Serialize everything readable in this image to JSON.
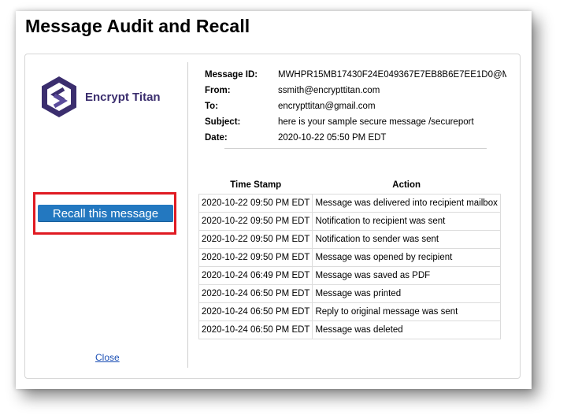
{
  "page": {
    "title": "Message Audit and Recall"
  },
  "logo": {
    "text": "Encrypt Titan"
  },
  "actions": {
    "recall_label": "Recall this message",
    "close_label": "Close"
  },
  "message": {
    "id_label": "Message ID:",
    "id_value": "MWHPR15MB17430F24E049367E7EB8B6E7EE1D0@M",
    "from_label": "From:",
    "from_value": "ssmith@encrypttitan.com",
    "to_label": "To:",
    "to_value": "encrypttitan@gmail.com",
    "subject_label": "Subject:",
    "subject_value": "here is your sample secure message /secureport",
    "date_label": "Date:",
    "date_value": "2020-10-22 05:50 PM EDT"
  },
  "audit": {
    "headers": [
      "Time Stamp",
      "Action"
    ],
    "rows": [
      [
        "2020-10-22 09:50 PM EDT",
        "Message was delivered into recipient mailbox"
      ],
      [
        "2020-10-22 09:50 PM EDT",
        "Notification to recipient was sent"
      ],
      [
        "2020-10-22 09:50 PM EDT",
        "Notification to sender was sent"
      ],
      [
        "2020-10-22 09:50 PM EDT",
        "Message was opened by recipient"
      ],
      [
        "2020-10-24 06:49 PM EDT",
        "Message was saved as PDF"
      ],
      [
        "2020-10-24 06:50 PM EDT",
        "Message was printed"
      ],
      [
        "2020-10-24 06:50 PM EDT",
        "Reply to original message was sent"
      ],
      [
        "2020-10-24 06:50 PM EDT",
        "Message was deleted"
      ]
    ]
  },
  "colors": {
    "accent": "#2378c0",
    "highlight_border": "#e01a22",
    "logo_primary": "#3b2e6e",
    "link": "#1b4fb5"
  },
  "icons": {
    "logo": "encrypt-titan-hexagon-logo-icon"
  }
}
